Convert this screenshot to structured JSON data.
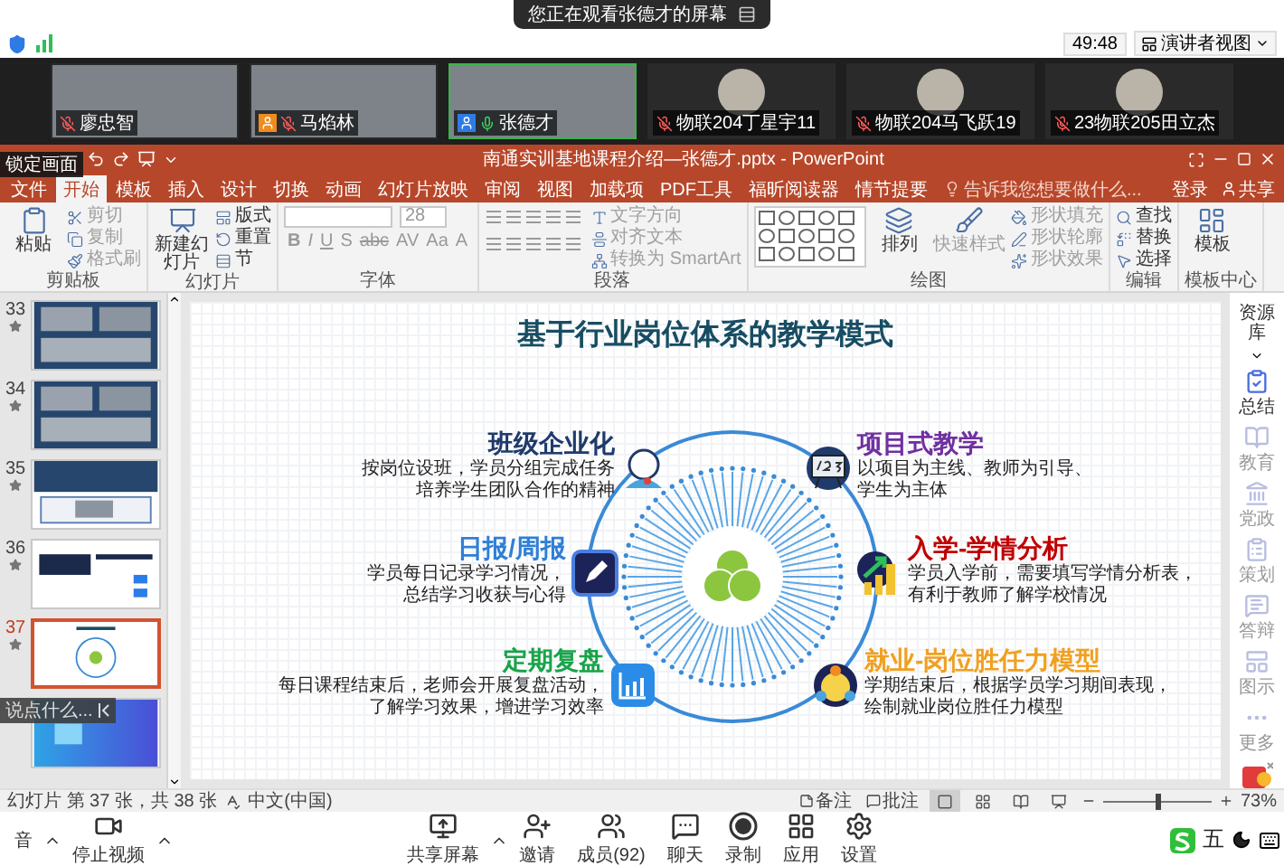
{
  "share_banner": {
    "text": "您正在观看张德才的屏幕"
  },
  "meeting_bar": {
    "timer": "49:48",
    "view_button": "演讲者视图"
  },
  "participants": [
    {
      "name": "廖忠智",
      "video": true,
      "active": false,
      "muted": true
    },
    {
      "name": "马焰林",
      "video": true,
      "active": false,
      "muted": true,
      "badge": {
        "color": "#f08c1e"
      }
    },
    {
      "name": "张德才",
      "video": true,
      "active": true,
      "muted": false,
      "badge": {
        "color": "#2f7be5"
      }
    },
    {
      "name": "物联204丁星宇11",
      "video": false,
      "active": false,
      "muted": true
    },
    {
      "name": "物联204马飞跃19",
      "video": false,
      "active": false,
      "muted": true
    },
    {
      "name": "23物联205田立杰",
      "video": false,
      "active": false,
      "muted": true
    }
  ],
  "powerpoint": {
    "title": "南通实训基地课程介绍—张德才.pptx - PowerPoint",
    "lock_tooltip": "锁定画面",
    "tabs": [
      {
        "label": "文件",
        "selected": false
      },
      {
        "label": "开始",
        "selected": true
      },
      {
        "label": "模板",
        "selected": false
      },
      {
        "label": "插入",
        "selected": false
      },
      {
        "label": "设计",
        "selected": false
      },
      {
        "label": "切换",
        "selected": false
      },
      {
        "label": "动画",
        "selected": false
      },
      {
        "label": "幻灯片放映",
        "selected": false
      },
      {
        "label": "审阅",
        "selected": false
      },
      {
        "label": "视图",
        "selected": false
      },
      {
        "label": "加载项",
        "selected": false
      },
      {
        "label": "PDF工具",
        "selected": false
      },
      {
        "label": "福昕阅读器",
        "selected": false
      },
      {
        "label": "情节提要",
        "selected": false
      }
    ],
    "tell_me": {
      "placeholder": "告诉我您想要做什么..."
    },
    "sign_in": "登录",
    "share": "共享",
    "ribbon": [
      {
        "kind": "basic",
        "label": "剪贴板",
        "big": [
          {
            "label": "粘贴",
            "kind": "paste",
            "disabled": false
          }
        ],
        "items": [
          {
            "label": "剪切",
            "kind": "cut",
            "disabled": true
          },
          {
            "label": "复制",
            "kind": "copy",
            "disabled": true
          },
          {
            "label": "格式刷",
            "kind": "brush",
            "disabled": true
          }
        ]
      },
      {
        "kind": "basic",
        "label": "幻灯片",
        "big": [
          {
            "label": "新建幻灯片",
            "kind": "new-slide",
            "disabled": false
          }
        ],
        "items": [
          {
            "label": "版式",
            "kind": "layout",
            "disabled": false
          },
          {
            "label": "重置",
            "kind": "reset",
            "disabled": false
          },
          {
            "label": "节",
            "kind": "section",
            "disabled": false
          }
        ]
      },
      {
        "kind": "font",
        "label": "字体",
        "font_size": "28",
        "format_buttons": [
          "B",
          "I",
          "U",
          "S",
          "abc",
          "AV",
          "Aa",
          "A"
        ]
      },
      {
        "kind": "paragraph",
        "label": "段落",
        "items": [
          {
            "label": "文字方向",
            "kind": "text-direction",
            "disabled": true
          },
          {
            "label": "对齐文本",
            "kind": "align",
            "disabled": true
          },
          {
            "label": "转换为 SmartArt",
            "kind": "smartart",
            "disabled": true
          }
        ]
      },
      {
        "kind": "drawing",
        "label": "绘图",
        "big": [
          {
            "label": "排列",
            "kind": "arrange",
            "disabled": false
          },
          {
            "label": "快速样式",
            "kind": "styles",
            "disabled": true
          }
        ],
        "items": [
          {
            "label": "形状填充",
            "kind": "fill",
            "disabled": true
          },
          {
            "label": "形状轮廓",
            "kind": "outline",
            "disabled": true
          },
          {
            "label": "形状效果",
            "kind": "effects",
            "disabled": true
          }
        ]
      },
      {
        "kind": "basic",
        "label": "编辑",
        "items": [
          {
            "label": "查找",
            "kind": "find",
            "disabled": false
          },
          {
            "label": "替换",
            "kind": "replace",
            "disabled": false
          },
          {
            "label": "选择",
            "kind": "select",
            "disabled": false
          }
        ]
      },
      {
        "kind": "basic",
        "label": "模板中心",
        "big": [
          {
            "label": "模板",
            "kind": "template",
            "disabled": false
          }
        ]
      }
    ]
  },
  "slides": [
    {
      "number": "33",
      "kind": "photo-collage",
      "selected": false
    },
    {
      "number": "34",
      "kind": "photo-collage",
      "selected": false
    },
    {
      "number": "35",
      "kind": "photo-banner",
      "selected": false
    },
    {
      "number": "36",
      "kind": "web-page",
      "selected": false
    },
    {
      "number": "37",
      "kind": "diagram",
      "selected": true
    },
    {
      "kind": "gradient",
      "selected": false
    }
  ],
  "chat_input": {
    "placeholder": "说点什么..."
  },
  "slide": {
    "title": "基于行业岗位体系的教学模式",
    "items": [
      {
        "title": "班级企业化",
        "color": "#1f3a6b",
        "kind": "headset",
        "lines": [
          "按岗位设班，学员分组完成任务",
          "培养学生团队合作的精神"
        ]
      },
      {
        "title": "项目式教学",
        "color": "#7030a0",
        "kind": "board",
        "lines": [
          "以项目为主线、教师为引导、",
          "学生为主体"
        ]
      },
      {
        "title": "日报/周报",
        "color": "#2f7fd6",
        "kind": "edit",
        "lines": [
          "学员每日记录学习情况，",
          "总结学习收获与心得"
        ]
      },
      {
        "title": "入学-学情分析",
        "color": "#c00000",
        "kind": "growth",
        "lines": [
          "学员入学前，需要填写学情分析表，",
          "有利于教师了解学校情况"
        ]
      },
      {
        "title": "定期复盘",
        "color": "#1aa34a",
        "kind": "chart",
        "lines": [
          "每日课程结束后，老师会开展复盘活动，",
          "了解学习效果，增进学习效率"
        ]
      },
      {
        "title": "就业-岗位胜任力模型",
        "color": "#f0a020",
        "kind": "team",
        "lines": [
          "学期结束后，根据学员学习期间表现，",
          "绘制就业岗位胜任力模型"
        ]
      }
    ]
  },
  "side_panel": {
    "title": "资源库",
    "items": [
      {
        "label": "总结",
        "kind": "summary",
        "selected": true
      },
      {
        "label": "教育",
        "kind": "education",
        "selected": false
      },
      {
        "label": "党政",
        "kind": "government",
        "selected": false
      },
      {
        "label": "策划",
        "kind": "planning",
        "selected": false
      },
      {
        "label": "答辩",
        "kind": "defense",
        "selected": false
      },
      {
        "label": "图示",
        "kind": "diagram",
        "selected": false
      },
      {
        "label": "更多",
        "kind": "more",
        "selected": false
      }
    ]
  },
  "status_bar": {
    "slide_info": "幻灯片 第 37 张，共 38 张",
    "language": "中文(中国)",
    "notes": "备注",
    "comments": "批注",
    "views": [
      {
        "kind": "normal",
        "selected": true
      },
      {
        "kind": "sorter",
        "selected": false
      },
      {
        "kind": "reading",
        "selected": false
      },
      {
        "kind": "slideshow",
        "selected": false
      }
    ],
    "zoom": {
      "level": 0.5
    },
    "zoom_reading": "73%"
  },
  "toolbar": {
    "left": [
      {
        "label": "音",
        "kind": "none",
        "caret": true
      },
      {
        "label": "停止视频",
        "kind": "camera",
        "caret": true
      }
    ],
    "center": [
      {
        "label": "共享屏幕",
        "kind": "share",
        "caret": true
      },
      {
        "label": "邀请",
        "kind": "invite",
        "caret": false
      },
      {
        "label": "成员(92)",
        "kind": "members",
        "caret": false
      },
      {
        "label": "聊天",
        "kind": "chat",
        "caret": false
      },
      {
        "label": "录制",
        "kind": "record",
        "caret": false
      },
      {
        "label": "应用",
        "kind": "apps",
        "caret": false
      },
      {
        "label": "设置",
        "kind": "settings",
        "caret": false
      }
    ],
    "ime": "五"
  }
}
